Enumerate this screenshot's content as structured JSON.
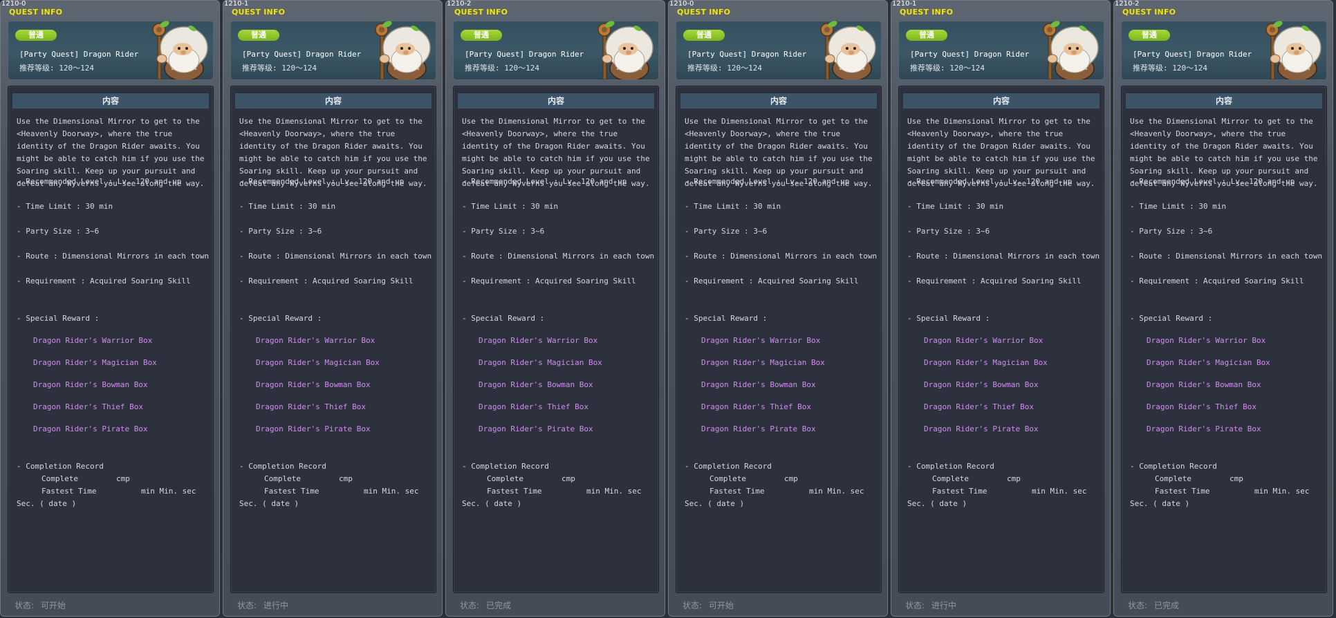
{
  "header_title": "QUEST INFO",
  "badge": "普通",
  "quest_name": "[Party Quest] Dragon Rider",
  "level_req": "推荐等级: 120～124",
  "section_title": "内容",
  "description": "Use the Dimensional Mirror to get to the <Heavenly Doorway>, where the true identity of the Dragon Rider awaits. You might be able to catch him if you use the Soaring skill. Keep up your pursuit and defeat any Wyverns you see along the way.",
  "info": {
    "recommended_level": "- Recommended Level : Lv. 120 and up",
    "time_limit": "- Time Limit : 30 min",
    "party_size": "- Party Size : 3~6",
    "route": "- Route : Dimensional Mirrors in each town",
    "requirement": "- Requirement : Acquired Soaring Skill",
    "special_reward": "- Special Reward :"
  },
  "rewards": [
    "Dragon Rider's Warrior Box",
    "Dragon Rider's Magician Box",
    "Dragon Rider's Bowman Box",
    "Dragon Rider's Thief Box",
    "Dragon Rider's Pirate Box"
  ],
  "completion": {
    "title": "- Completion Record",
    "complete_label": "Complete",
    "complete_unit": "cmp",
    "fastest_label": "Fastest Time",
    "fastest_units": "min  Min. sec",
    "sec_date": "Sec. ( date )"
  },
  "status_label": "状态:",
  "panels": [
    {
      "id": "1210-0",
      "status": "可开始"
    },
    {
      "id": "1210-1",
      "status": "进行中"
    },
    {
      "id": "1210-2",
      "status": "已完成"
    },
    {
      "id": "1210-0",
      "status": "可开始"
    },
    {
      "id": "1210-1",
      "status": "进行中"
    },
    {
      "id": "1210-2",
      "status": "已完成"
    }
  ],
  "colors": {
    "title_yellow": "#f2e600",
    "badge_green": "#8cc72a",
    "reward_purple": "#cd8eea",
    "content_bg": "#2d313e",
    "panel_bg": "#4e5661"
  },
  "npc_icon": "white-bearded-sage-with-staff"
}
